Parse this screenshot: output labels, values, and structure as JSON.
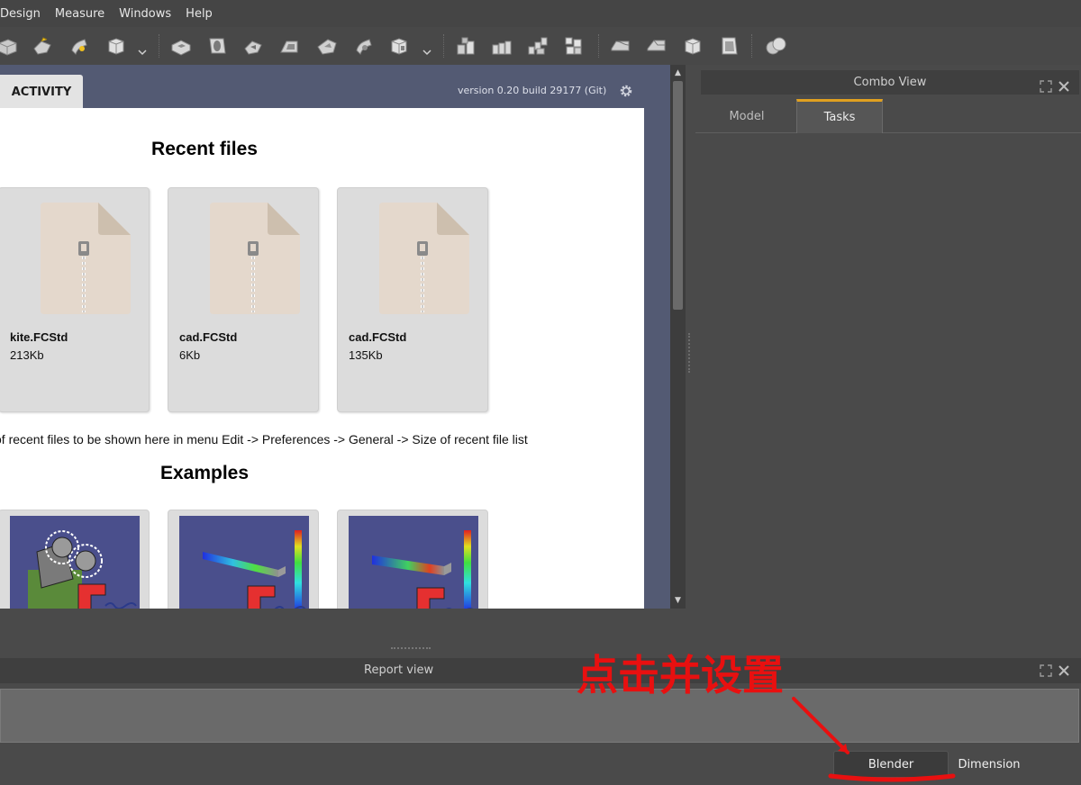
{
  "menubar": {
    "items": [
      "Design",
      "Measure",
      "Windows",
      "Help"
    ]
  },
  "toolbar": {
    "icons": [
      "pad-icon",
      "revolution-icon",
      "loft-icon",
      "sweep-icon",
      "box-icon",
      "pocket-icon",
      "hole-icon",
      "groove-icon",
      "subtractive-loft-icon",
      "subtractive-sweep-icon",
      "subtractive-box-icon",
      "mirrored-icon",
      "linear-pattern-icon",
      "polar-pattern-icon",
      "multi-transform-icon",
      "fillet-icon",
      "chamfer-icon",
      "draft-icon",
      "thickness-icon",
      "boolean-icon"
    ]
  },
  "start": {
    "tab_label": "ACTIVITY",
    "version": "version 0.20 build 29177 (Git)",
    "recent_title": "Recent files",
    "files": [
      {
        "name": "kite.FCStd",
        "size": "213Kb"
      },
      {
        "name": "cad.FCStd",
        "size": "6Kb"
      },
      {
        "name": "cad.FCStd",
        "size": "135Kb"
      }
    ],
    "hint": "of recent files to be shown here in menu Edit -> Preferences -> General -> Size of recent file list",
    "examples_title": "Examples"
  },
  "combo": {
    "title": "Combo View",
    "tabs": [
      "Model",
      "Tasks"
    ],
    "active_tab": "Tasks"
  },
  "report": {
    "title": "Report view"
  },
  "workbench_tabs": {
    "active": "Blender",
    "other": "Dimension"
  },
  "annotation": {
    "text": "点击并设置",
    "color": "#e81010"
  }
}
